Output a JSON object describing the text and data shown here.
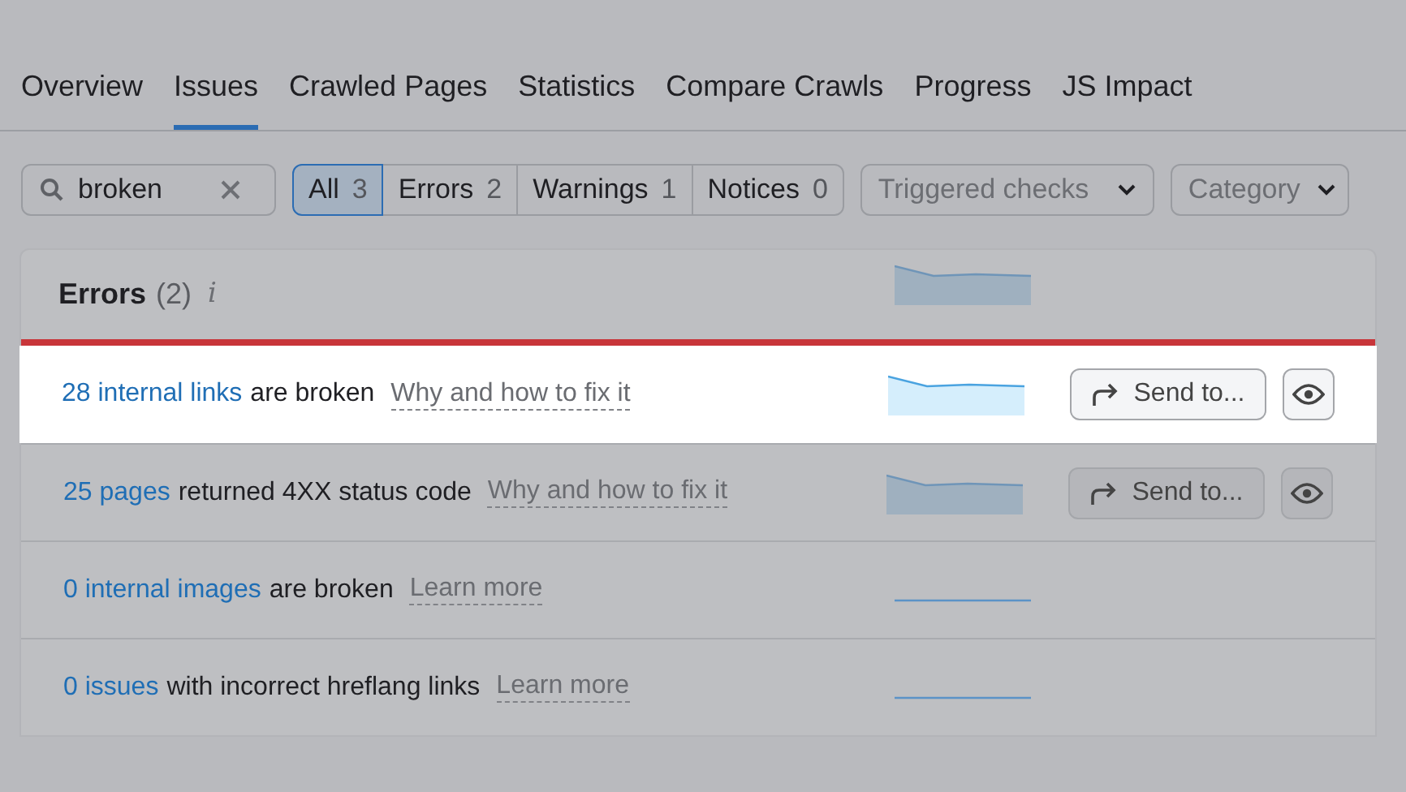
{
  "tabs": [
    {
      "label": "Overview",
      "selected": false
    },
    {
      "label": "Issues",
      "selected": true
    },
    {
      "label": "Crawled Pages",
      "selected": false
    },
    {
      "label": "Statistics",
      "selected": false
    },
    {
      "label": "Compare Crawls",
      "selected": false
    },
    {
      "label": "Progress",
      "selected": false
    },
    {
      "label": "JS Impact",
      "selected": false
    }
  ],
  "search": {
    "value": "broken"
  },
  "filters": [
    {
      "label": "All",
      "count": "3",
      "selected": true
    },
    {
      "label": "Errors",
      "count": "2",
      "selected": false
    },
    {
      "label": "Warnings",
      "count": "1",
      "selected": false
    },
    {
      "label": "Notices",
      "count": "0",
      "selected": false
    }
  ],
  "dropdowns": [
    "Triggered checks",
    "Category"
  ],
  "section": {
    "title": "Errors",
    "count": "(2)",
    "info": "i",
    "sparkline": {
      "kind": "area"
    }
  },
  "rows": [
    {
      "link": "28 internal links",
      "text": "are broken",
      "help": "Why and how to fix it",
      "sparkline": {
        "kind": "area"
      },
      "send_button": "Send to...",
      "highlighted": true
    },
    {
      "link": "25 pages",
      "text": "returned 4XX status code",
      "help": "Why and how to fix it",
      "sparkline": {
        "kind": "area"
      },
      "send_button": "Send to...",
      "highlighted": false
    },
    {
      "link": "0 internal images",
      "text": "are broken",
      "help": "Learn more",
      "sparkline": {
        "kind": "flat"
      },
      "highlighted": false
    },
    {
      "link": "0 issues",
      "text": "with incorrect hreflang links",
      "help": "Learn more",
      "sparkline": {
        "kind": "flat"
      },
      "highlighted": false
    }
  ]
}
